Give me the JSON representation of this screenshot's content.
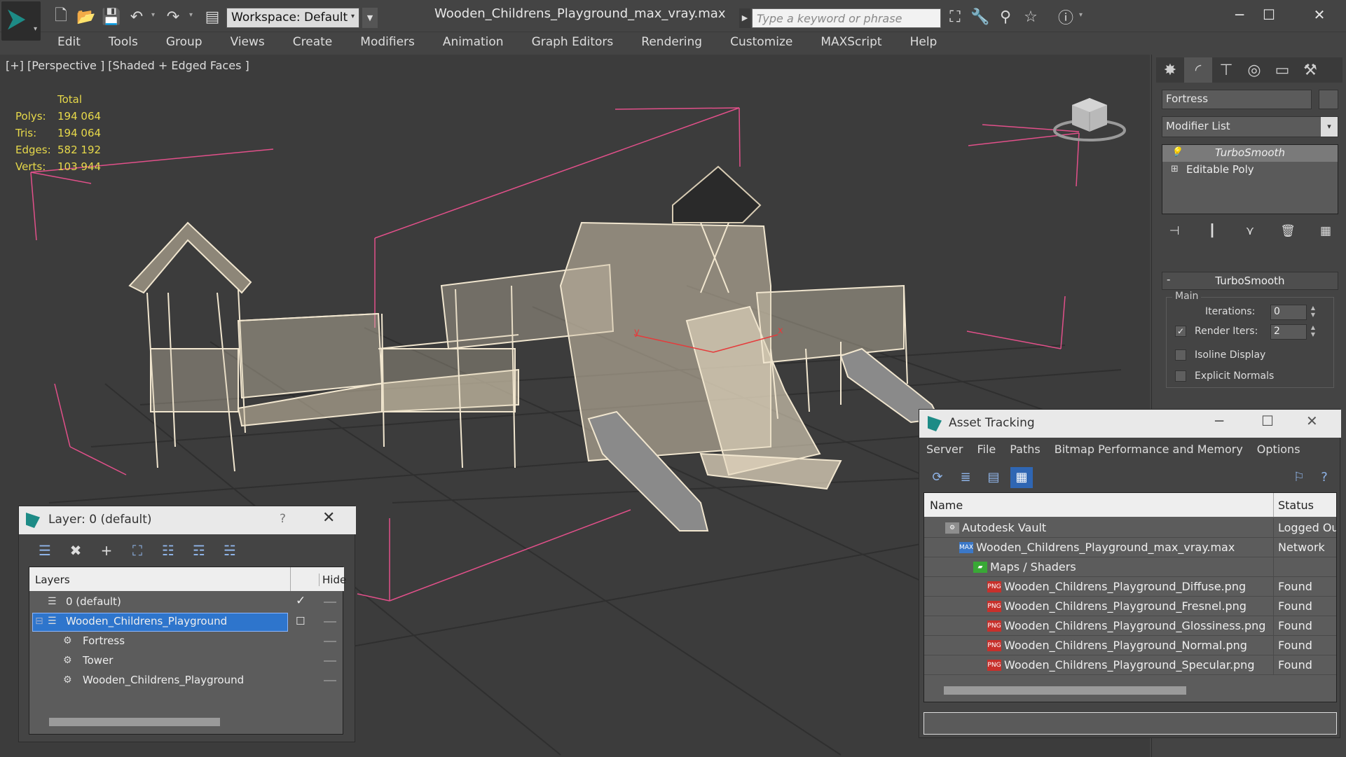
{
  "app": {
    "window_title": "Wooden_Childrens_Playground_max_vray.max",
    "workspace": "Workspace: Default",
    "search_placeholder": "Type a keyword or phrase"
  },
  "menu": [
    "Edit",
    "Tools",
    "Group",
    "Views",
    "Create",
    "Modifiers",
    "Animation",
    "Graph Editors",
    "Rendering",
    "Customize",
    "MAXScript",
    "Help"
  ],
  "viewport": {
    "label": "[+] [Perspective ] [Shaded + Edged Faces ]",
    "stats": {
      "total_label": "Total",
      "rows": [
        {
          "label": "Polys:",
          "value": "194 064"
        },
        {
          "label": "Tris:",
          "value": "194 064"
        },
        {
          "label": "Edges:",
          "value": "582 192"
        },
        {
          "label": "Verts:",
          "value": "103 944"
        }
      ]
    }
  },
  "command_panel": {
    "object_name": "Fortress",
    "modifier_list": "Modifier List",
    "stack": [
      "TurboSmooth",
      "Editable Poly"
    ],
    "rollout": {
      "title": "TurboSmooth",
      "group": "Main",
      "iterations_label": "Iterations:",
      "iterations": "0",
      "render_iters_label": "Render Iters:",
      "render_iters": "2",
      "render_iters_checked": true,
      "isoline_label": "Isoline Display",
      "explicit_normals_label": "Explicit Normals"
    }
  },
  "layer_panel": {
    "title": "Layer: 0 (default)",
    "help": "?",
    "col_layers": "Layers",
    "col_hide": "Hide",
    "rows": [
      {
        "name": "0 (default)",
        "level": 0,
        "selected": false,
        "current": true
      },
      {
        "name": "Wooden_Childrens_Playground",
        "level": 0,
        "selected": true,
        "current": false
      },
      {
        "name": "Fortress",
        "level": 1,
        "selected": false,
        "current": false
      },
      {
        "name": "Tower",
        "level": 1,
        "selected": false,
        "current": false
      },
      {
        "name": "Wooden_Childrens_Playground",
        "level": 1,
        "selected": false,
        "current": false
      }
    ]
  },
  "asset_tracking": {
    "title": "Asset Tracking",
    "menu": [
      "Server",
      "File",
      "Paths",
      "Bitmap Performance and Memory",
      "Options"
    ],
    "col_name": "Name",
    "col_status": "Status",
    "rows": [
      {
        "name": "Autodesk Vault",
        "level": 0,
        "icon": "vault",
        "status": "Logged Out"
      },
      {
        "name": "Wooden_Childrens_Playground_max_vray.max",
        "level": 1,
        "icon": "max",
        "status": "Network"
      },
      {
        "name": "Maps / Shaders",
        "level": 2,
        "icon": "maps",
        "status": ""
      },
      {
        "name": "Wooden_Childrens_Playground_Diffuse.png",
        "level": 3,
        "icon": "png",
        "status": "Found"
      },
      {
        "name": "Wooden_Childrens_Playground_Fresnel.png",
        "level": 3,
        "icon": "png",
        "status": "Found"
      },
      {
        "name": "Wooden_Childrens_Playground_Glossiness.png",
        "level": 3,
        "icon": "png",
        "status": "Found"
      },
      {
        "name": "Wooden_Childrens_Playground_Normal.png",
        "level": 3,
        "icon": "png",
        "status": "Found"
      },
      {
        "name": "Wooden_Childrens_Playground_Specular.png",
        "level": 3,
        "icon": "png",
        "status": "Found"
      }
    ]
  },
  "colors": {
    "stats": "#e7d94a",
    "selection": "#2e75cc",
    "wire": "#f1e6cf",
    "bbox": "#e2508a",
    "grid": "#2e2e2e"
  }
}
